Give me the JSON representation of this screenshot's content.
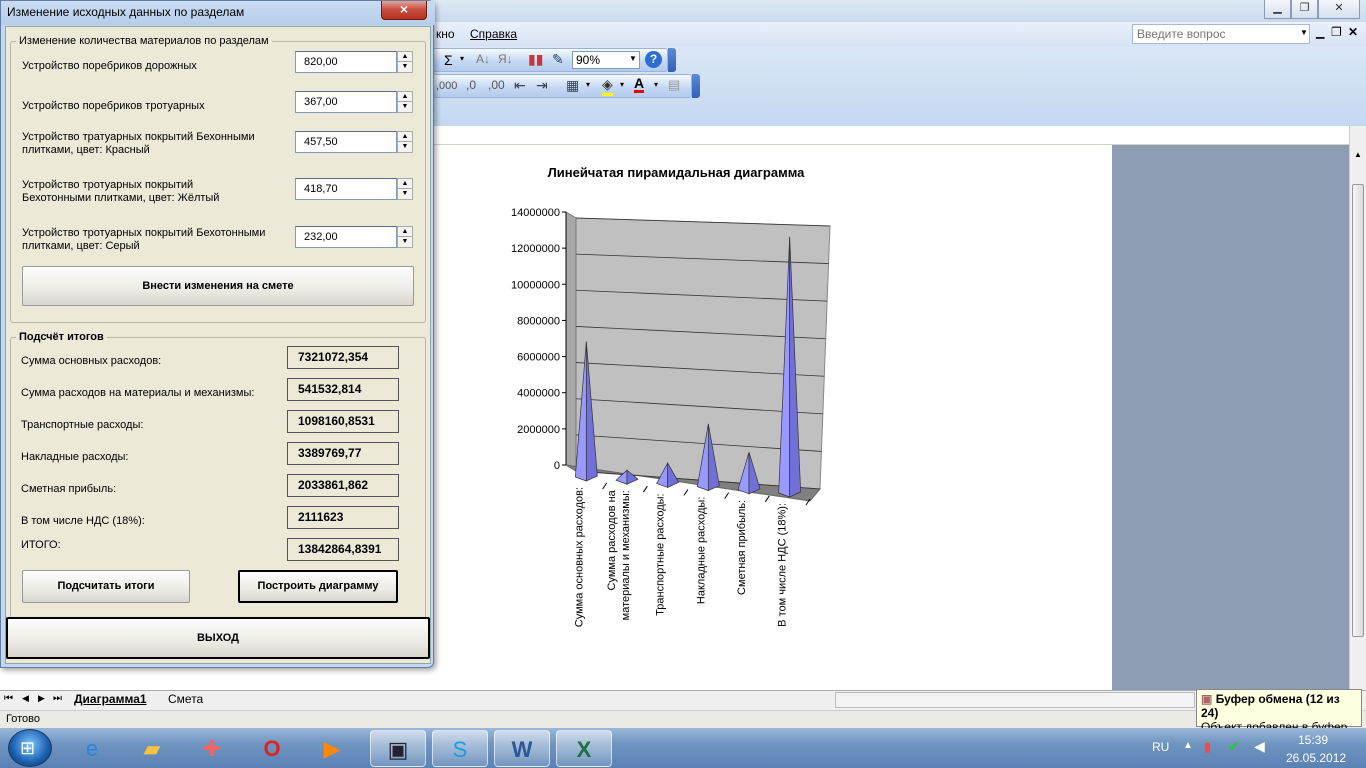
{
  "excel": {
    "menu_window_fragment": "кно",
    "menu_help": "Справка",
    "zoom": "90%",
    "ask_placeholder": "Введите вопрос",
    "status_ready": "Готово",
    "tabs": [
      "Диаграмма1",
      "Смета"
    ],
    "toolbar_icons": [
      "sum-icon",
      "sort-asc-icon",
      "sort-desc-icon",
      "chart-wizard-icon",
      "drawing-icon",
      "help-icon",
      "thousands-icon",
      "decrease-indent-icon",
      "increase-indent-icon",
      "borders-icon",
      "fill-color-icon",
      "font-color-icon"
    ],
    "toolbar_thousands": ",000"
  },
  "clipboard": {
    "title": "Буфер обмена (12 из 24)",
    "message": "Объект добавлен в буфер."
  },
  "dialog": {
    "title": "Изменение исходных данных по разделам",
    "close_label": "×",
    "materials_group": "Изменение количества материалов по разделам",
    "materials": [
      {
        "label": "Устройство поребриков дорожных",
        "value": "820,00"
      },
      {
        "label": "Устройство поребриков тротуарных",
        "value": "367,00"
      },
      {
        "label": "Устройство тратуарных покрытий Бехонными плитками, цвет: Красный",
        "value": "457,50"
      },
      {
        "label": "Устройство тротуарных покрытий Бехотонными плитками, цвет: Жёлтый",
        "value": "418,70"
      },
      {
        "label": "Устройство тротуарных покрытий Бехотонными плитками, цвет: Серый",
        "value": "232,00"
      }
    ],
    "apply_button": "Внести изменения на смете",
    "totals_group": "Подсчёт итогов",
    "totals": [
      {
        "label": "Сумма основных расходов:",
        "value": "7321072,354"
      },
      {
        "label": "Сумма расходов на материалы и механизмы:",
        "value": "541532,814"
      },
      {
        "label": "Транспортные расходы:",
        "value": "1098160,8531"
      },
      {
        "label": "Накладные расходы:",
        "value": "3389769,77"
      },
      {
        "label": "Сметная прибыль:",
        "value": "2033861,862"
      },
      {
        "label": "В том числе НДС (18%):",
        "value": "2111623"
      },
      {
        "label": "ИТОГО:",
        "value": "13842864,8391"
      }
    ],
    "calc_button": "Подсчитать итоги",
    "chart_button": "Построить диаграмму",
    "exit_button": "ВЫХОД"
  },
  "taskbar": {
    "lang": "RU",
    "time": "15:39",
    "date": "26.05.2012",
    "apps": [
      "internet-explorer-icon",
      "folder-icon",
      "tool-icon",
      "opera-icon",
      "media-player-icon",
      "save-icon",
      "skype-icon",
      "word-icon",
      "excel-icon"
    ]
  },
  "chart_data": {
    "type": "bar",
    "title": "Линейчатая пирамидальная диаграмма",
    "categories": [
      "Сумма основных расходов:",
      "Сумма расходов на материалы и механизмы:",
      "Транспортные расходы:",
      "Накладные расходы:",
      "Сметная прибыль:",
      "В том числе НДС (18%):"
    ],
    "values": [
      7321072.354,
      541532.814,
      1098160.8531,
      3389769.77,
      2033861.862,
      13842864.8391
    ],
    "yticks": [
      "0",
      "2000000",
      "4000000",
      "6000000",
      "8000000",
      "10000000",
      "12000000",
      "14000000"
    ],
    "ylim": [
      0,
      14000000
    ],
    "bar_color": "#9999ff",
    "wall_color": "#c0c0c0"
  }
}
